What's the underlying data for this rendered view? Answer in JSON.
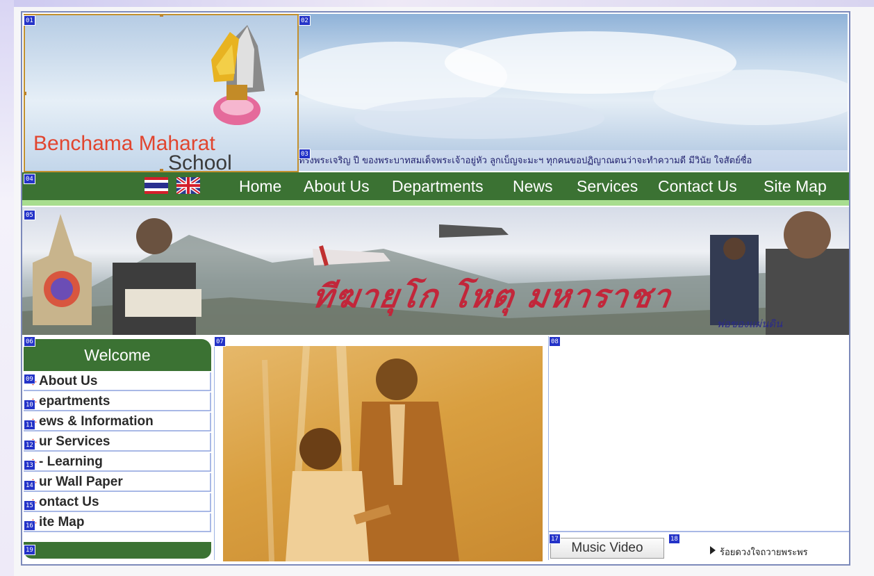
{
  "site": {
    "name_line1": "Benchama Maharat",
    "name_line2": "School"
  },
  "marquee_text": "ทรงพระเจริญ ปี ของพระบาทสมเด็จพระเจ้าอยู่หัว ลูกเบ็ญจะมะฯ ทุกคนขอปฏิญาณตนว่าจะทำความดี มีวินัย ใจสัตย์ซื่อ",
  "nav": {
    "items": [
      {
        "label": "Home"
      },
      {
        "label": "About Us"
      },
      {
        "label": "Departments"
      },
      {
        "label": "News"
      },
      {
        "label": "Services"
      },
      {
        "label": "Contact Us"
      },
      {
        "label": "Site Map"
      }
    ]
  },
  "hero": {
    "title": "ทีฆายุโก โหตุ มหาราชา",
    "subtitle": "พ่อของแผ่นดิน"
  },
  "sidebar": {
    "title": "Welcome",
    "items": [
      {
        "label": "About Us"
      },
      {
        "label": "epartments"
      },
      {
        "label": "ews & Information"
      },
      {
        "label": "ur Services"
      },
      {
        "label": "- Learning"
      },
      {
        "label": "ur Wall Paper"
      },
      {
        "label": "ontact Us"
      },
      {
        "label": "ite Map"
      }
    ]
  },
  "media": {
    "music_label": "Music Video",
    "song_link": "ร้อยดวงใจถวายพระพร"
  },
  "slice_tags": {
    "t01": "01",
    "t02": "02",
    "t03": "03",
    "t04": "04",
    "t05": "05",
    "t06": "06",
    "t07": "07",
    "t08": "08",
    "t09": "09",
    "t10": "10",
    "t11": "11",
    "t12": "12",
    "t13": "13",
    "t14": "14",
    "t15": "15",
    "t16": "16",
    "t17": "17",
    "t18": "18",
    "t19": "19"
  },
  "colors": {
    "nav_green": "#3b7233",
    "nav_underline": "#a8dd8f",
    "brand_red": "#e1452f",
    "tag_blue": "#2433c8",
    "panel_border": "#7c89ba"
  }
}
